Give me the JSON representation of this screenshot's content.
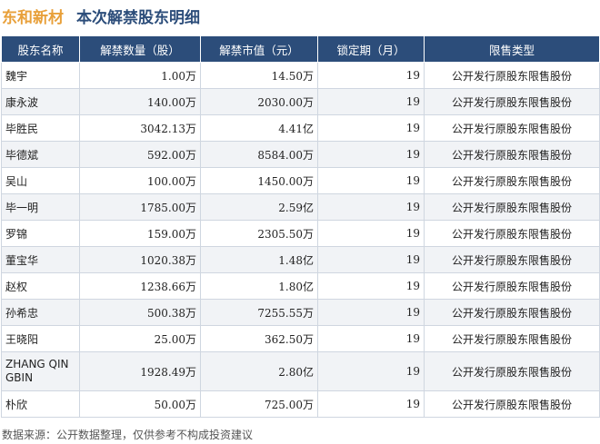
{
  "header": {
    "company": "东和新材",
    "title": "本次解禁股东明细"
  },
  "table": {
    "columns": [
      "股东名称",
      "解禁数量（股）",
      "解禁市值（元）",
      "锁定期（月）",
      "限售类型"
    ],
    "rows": [
      {
        "name": "魏宇",
        "qty": "1.00万",
        "value": "14.50万",
        "lock": "19",
        "type": "公开发行原股东限售股份"
      },
      {
        "name": "康永波",
        "qty": "140.00万",
        "value": "2030.00万",
        "lock": "19",
        "type": "公开发行原股东限售股份"
      },
      {
        "name": "毕胜民",
        "qty": "3042.13万",
        "value": "4.41亿",
        "lock": "19",
        "type": "公开发行原股东限售股份"
      },
      {
        "name": "毕德斌",
        "qty": "592.00万",
        "value": "8584.00万",
        "lock": "19",
        "type": "公开发行原股东限售股份"
      },
      {
        "name": "吴山",
        "qty": "100.00万",
        "value": "1450.00万",
        "lock": "19",
        "type": "公开发行原股东限售股份"
      },
      {
        "name": "毕一明",
        "qty": "1785.00万",
        "value": "2.59亿",
        "lock": "19",
        "type": "公开发行原股东限售股份"
      },
      {
        "name": "罗锦",
        "qty": "159.00万",
        "value": "2305.50万",
        "lock": "19",
        "type": "公开发行原股东限售股份"
      },
      {
        "name": "董宝华",
        "qty": "1020.38万",
        "value": "1.48亿",
        "lock": "19",
        "type": "公开发行原股东限售股份"
      },
      {
        "name": "赵权",
        "qty": "1238.66万",
        "value": "1.80亿",
        "lock": "19",
        "type": "公开发行原股东限售股份"
      },
      {
        "name": "孙希忠",
        "qty": "500.38万",
        "value": "7255.55万",
        "lock": "19",
        "type": "公开发行原股东限售股份"
      },
      {
        "name": "王晓阳",
        "qty": "25.00万",
        "value": "362.50万",
        "lock": "19",
        "type": "公开发行原股东限售股份"
      },
      {
        "name": "ZHANG QINGBIN",
        "qty": "1928.49万",
        "value": "2.80亿",
        "lock": "19",
        "type": "公开发行原股东限售股份"
      },
      {
        "name": "朴欣",
        "qty": "50.00万",
        "value": "725.00万",
        "lock": "19",
        "type": "公开发行原股东限售股份"
      }
    ]
  },
  "footer": {
    "source": "数据来源：公开数据整理，仅供参考不构成投资建议"
  },
  "colors": {
    "header_bg": "#2c4d7a",
    "company_title": "#e8a03a",
    "alt_row": "#f1f3f6"
  }
}
